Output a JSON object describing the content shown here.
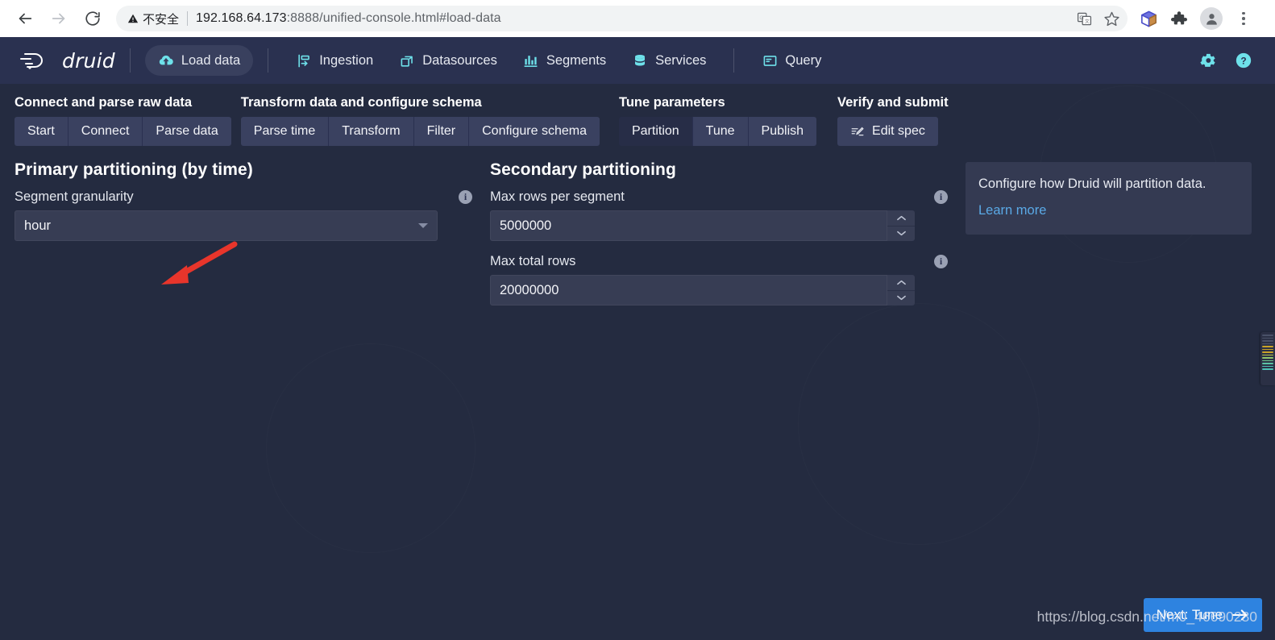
{
  "browser": {
    "back_icon": "back-arrow-icon",
    "forward_icon": "forward-arrow-icon",
    "reload_icon": "reload-icon",
    "security_label": "不安全",
    "url_host": "192.168.64.173",
    "url_rest": ":8888/unified-console.html#load-data",
    "actions": [
      {
        "name": "translate-icon",
        "label": "translate"
      },
      {
        "name": "bookmark-star-icon",
        "label": "bookmark"
      }
    ],
    "toolbar_icons": [
      {
        "name": "cube-extension-icon",
        "label": "cube"
      },
      {
        "name": "extensions-puzzle-icon",
        "label": "extensions"
      },
      {
        "name": "profile-avatar-icon",
        "label": "profile"
      },
      {
        "name": "more-menu-icon",
        "label": "more"
      }
    ]
  },
  "app": {
    "brand": "druid",
    "nav": [
      {
        "label": "Load data",
        "icon": "upload-cloud-icon",
        "active": true
      },
      {
        "label": "Ingestion",
        "icon": "ingestion-icon",
        "active": false
      },
      {
        "label": "Datasources",
        "icon": "datasources-icon",
        "active": false
      },
      {
        "label": "Segments",
        "icon": "segments-bar-chart-icon",
        "active": false
      },
      {
        "label": "Services",
        "icon": "services-database-icon",
        "active": false
      },
      {
        "label": "Query",
        "icon": "query-console-icon",
        "active": false
      }
    ],
    "nav_right": [
      {
        "label": "Settings",
        "icon": "gear-icon"
      },
      {
        "label": "Help",
        "icon": "help-circle-icon"
      }
    ]
  },
  "steps": [
    {
      "title": "Connect and parse raw data",
      "buttons": [
        {
          "label": "Start",
          "active": false
        },
        {
          "label": "Connect",
          "active": false
        },
        {
          "label": "Parse data",
          "active": false
        }
      ]
    },
    {
      "title": "Transform data and configure schema",
      "buttons": [
        {
          "label": "Parse time",
          "active": false
        },
        {
          "label": "Transform",
          "active": false
        },
        {
          "label": "Filter",
          "active": false
        },
        {
          "label": "Configure schema",
          "active": false
        }
      ]
    },
    {
      "title": "Tune parameters",
      "buttons": [
        {
          "label": "Partition",
          "active": true
        },
        {
          "label": "Tune",
          "active": false
        },
        {
          "label": "Publish",
          "active": false
        }
      ]
    },
    {
      "title": "Verify and submit",
      "buttons": [
        {
          "label": "Edit spec",
          "active": false,
          "icon": "edit-spec-icon"
        }
      ]
    }
  ],
  "primary": {
    "section_title": "Primary partitioning (by time)",
    "segment_granularity": {
      "label": "Segment granularity",
      "value": "hour",
      "info_icon": "info-icon",
      "caret_icon": "chevron-down-icon"
    }
  },
  "secondary": {
    "section_title": "Secondary partitioning",
    "max_rows_per_segment": {
      "label": "Max rows per segment",
      "value": "5000000",
      "info_icon": "info-icon"
    },
    "max_total_rows": {
      "label": "Max total rows",
      "value": "20000000",
      "info_icon": "info-icon"
    }
  },
  "info_card": {
    "text": "Configure how Druid will partition data.",
    "link": "Learn more"
  },
  "footer": {
    "next_label": "Next: Tune",
    "next_icon": "arrow-right-icon"
  },
  "watermark": {
    "text": "https://blog.csdn.net/m0_46690280"
  },
  "annotation": {
    "arrow_color": "#e8352b",
    "arrow_name": "red-pointer-arrow"
  },
  "colors": {
    "app_bg": "#242b40",
    "navbar_bg": "#2a3150",
    "input_bg": "#373d54",
    "accent_cyan": "#6ee1ea",
    "primary_blue": "#2e83e0",
    "link_blue": "#5aa9e6",
    "card_bg": "#343a52"
  }
}
